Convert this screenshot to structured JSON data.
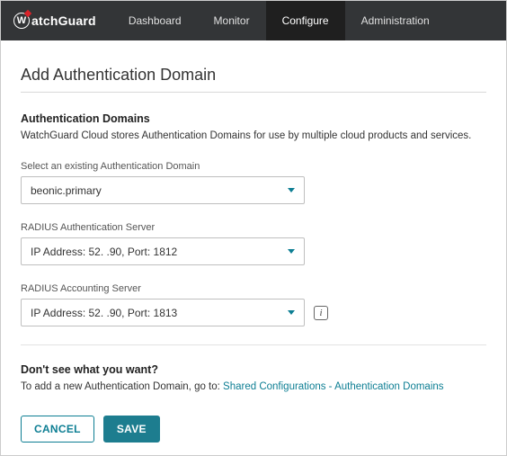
{
  "brand": "atchGuard",
  "nav": {
    "items": [
      {
        "label": "Dashboard",
        "active": false
      },
      {
        "label": "Monitor",
        "active": false
      },
      {
        "label": "Configure",
        "active": true
      },
      {
        "label": "Administration",
        "active": false
      }
    ]
  },
  "page": {
    "title": "Add Authentication Domain",
    "section_heading": "Authentication Domains",
    "section_desc": "WatchGuard Cloud stores Authentication Domains for use by multiple cloud products and services.",
    "fields": {
      "domain": {
        "label": "Select an existing Authentication Domain",
        "value": "beonic.primary"
      },
      "radius_auth": {
        "label": "RADIUS Authentication Server",
        "value": "IP Address: 52.        .90,  Port: 1812"
      },
      "radius_acct": {
        "label": "RADIUS Accounting Server",
        "value": "IP Address: 52.        .90,  Port: 1813"
      }
    },
    "footer": {
      "heading": "Don't see what you want?",
      "prefix": "To add a new Authentication Domain, go to: ",
      "link": "Shared Configurations - Authentication Domains"
    },
    "actions": {
      "cancel": "CANCEL",
      "save": "SAVE"
    }
  }
}
